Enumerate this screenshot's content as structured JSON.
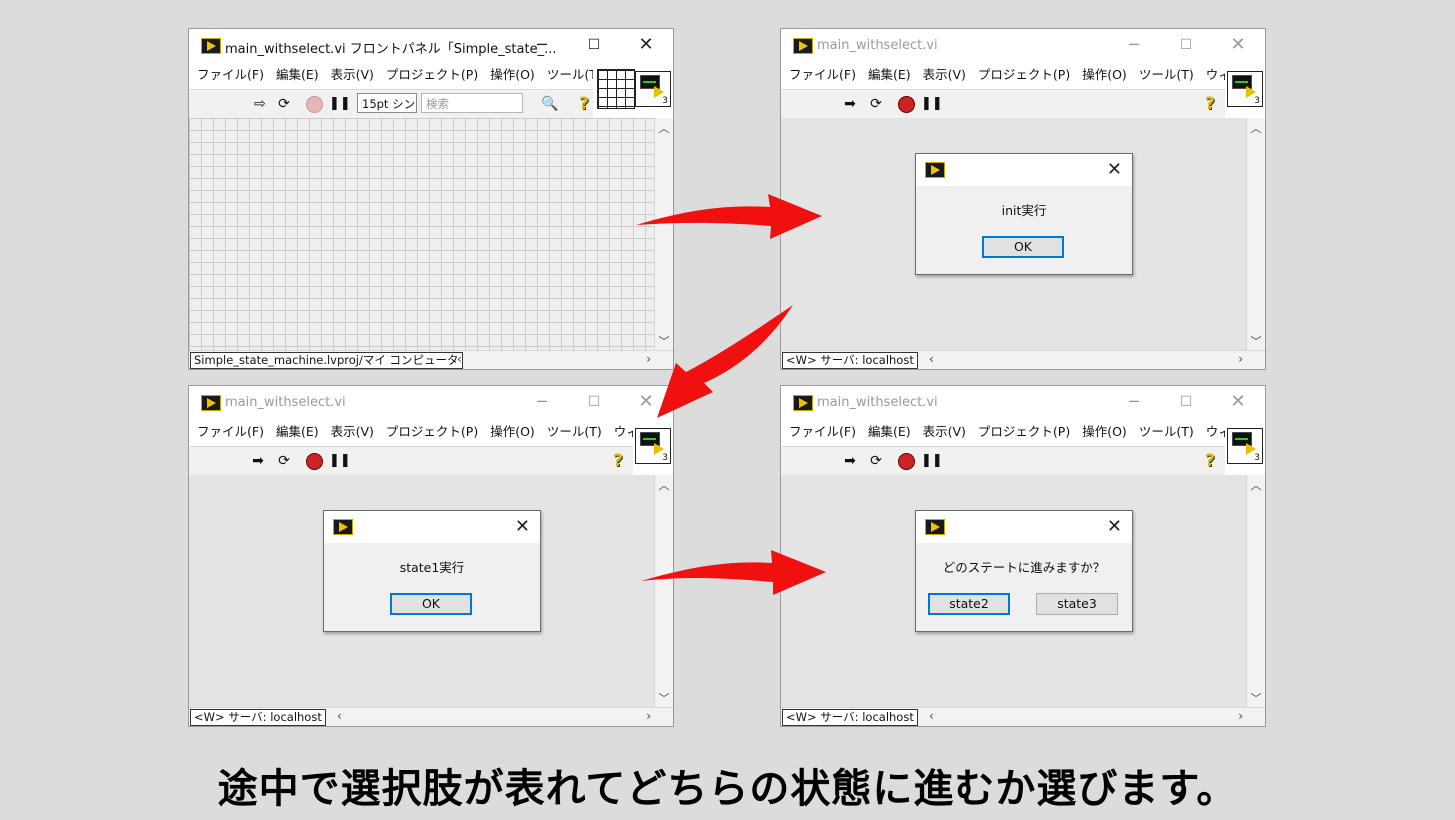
{
  "colors": {
    "arrow": "#f01010",
    "stop": "#cc2424",
    "dialog_focus": "#0078d7",
    "help": "#d8b800"
  },
  "icons": {
    "app": "labview-run-icon",
    "vi": "vi-icon",
    "connector": "connector-pane-icon"
  },
  "windows": [
    {
      "title": "main_withselect.vi フロントパネル「Simple_state_...",
      "menus": [
        "ファイル(F)",
        "編集(E)",
        "表示(V)",
        "プロジェクト(P)",
        "操作(O)",
        "ツール(T)"
      ],
      "font_box": "15pt シン",
      "search_placeholder": "検索",
      "status": "Simple_state_machine.lvproj/マイ コンピュータ",
      "vi_number": "3"
    },
    {
      "title": "main_withselect.vi",
      "menus": [
        "ファイル(F)",
        "編集(E)",
        "表示(V)",
        "プロジェクト(P)",
        "操作(O)",
        "ツール(T)",
        "ウィン"
      ],
      "status": "<W> サーバ: localhost",
      "vi_number": "3",
      "dialog": {
        "message": "init実行",
        "buttons": [
          "OK"
        ]
      }
    },
    {
      "title": "main_withselect.vi",
      "menus": [
        "ファイル(F)",
        "編集(E)",
        "表示(V)",
        "プロジェクト(P)",
        "操作(O)",
        "ツール(T)",
        "ウィン"
      ],
      "status": "<W> サーバ: localhost",
      "vi_number": "3",
      "dialog": {
        "message": "state1実行",
        "buttons": [
          "OK"
        ]
      }
    },
    {
      "title": "main_withselect.vi",
      "menus": [
        "ファイル(F)",
        "編集(E)",
        "表示(V)",
        "プロジェクト(P)",
        "操作(O)",
        "ツール(T)",
        "ウィン"
      ],
      "status": "<W> サーバ: localhost",
      "vi_number": "3",
      "dialog": {
        "message": "どのステートに進みますか？",
        "buttons": [
          "state2",
          "state3"
        ]
      }
    }
  ],
  "caption": "途中で選択肢が表れてどちらの状態に進むか選びます。"
}
